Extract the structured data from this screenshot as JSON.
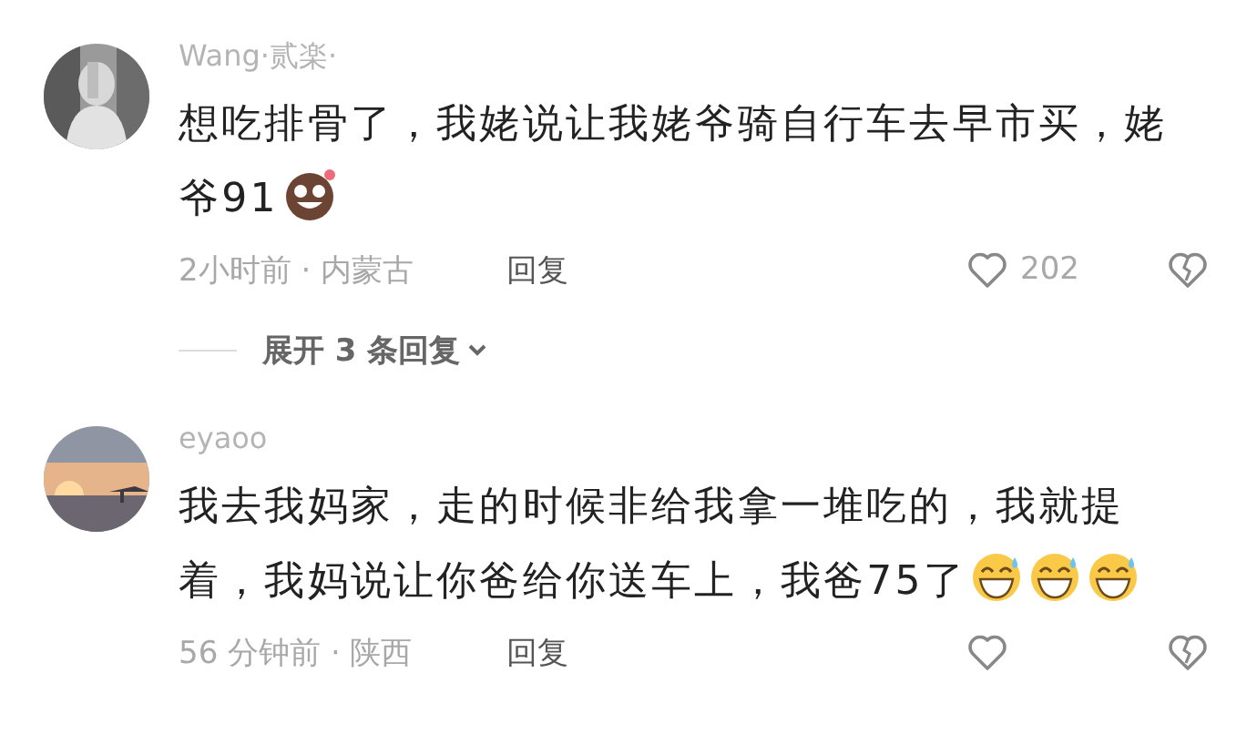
{
  "comments": [
    {
      "username": "Wang·贰楽·",
      "text": "想吃排骨了，我姥说让我姥爷骑自行车去早市买，姥爷91",
      "emojis": [
        {
          "kind": "brown-grin"
        }
      ],
      "time_location": "2小时前 · 内蒙古",
      "reply": "回复",
      "likes": "202",
      "expand": "展开 3 条回复"
    },
    {
      "username": "eyaoo",
      "text": "我去我妈家，走的时候非给我拿一堆吃的，我就提着，我妈说让你爸给你送车上，我爸75了",
      "emojis": [
        {
          "kind": "sweat-grin"
        },
        {
          "kind": "sweat-grin"
        },
        {
          "kind": "sweat-grin"
        }
      ],
      "time_location": "56 分钟前 · 陕西",
      "reply": "回复"
    }
  ]
}
